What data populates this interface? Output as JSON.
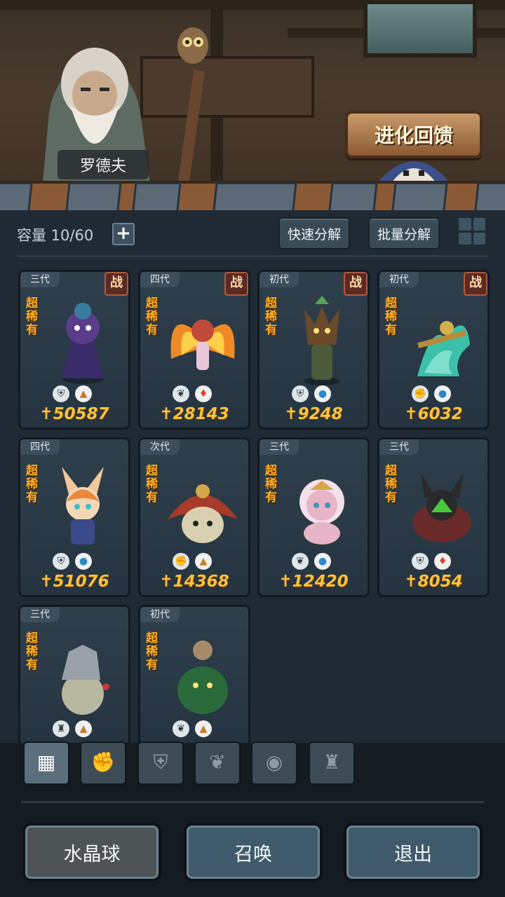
{
  "scene": {
    "npc_name": "罗德夫",
    "evolve_label": "进化回馈"
  },
  "toolbar": {
    "capacity_label": "容量 10/60",
    "add_label": "+",
    "quick_decompose": "快速分解",
    "batch_decompose": "批量分解"
  },
  "cards": [
    {
      "gen": "三代",
      "rarity": "超稀有",
      "battle": "战",
      "type_icon": "shield-icon",
      "element_icon": "earth-icon",
      "power": "50587"
    },
    {
      "gen": "四代",
      "rarity": "超稀有",
      "battle": "战",
      "type_icon": "leaf-icon",
      "element_icon": "fire-icon",
      "power": "28143"
    },
    {
      "gen": "初代",
      "rarity": "超稀有",
      "battle": "战",
      "type_icon": "shield-icon",
      "element_icon": "water-icon",
      "power": "9248"
    },
    {
      "gen": "初代",
      "rarity": "超稀有",
      "battle": "战",
      "type_icon": "fist-icon",
      "element_icon": "water-icon",
      "power": "6032"
    },
    {
      "gen": "四代",
      "rarity": "超稀有",
      "battle": "",
      "type_icon": "shield-icon",
      "element_icon": "water-icon",
      "power": "51076"
    },
    {
      "gen": "次代",
      "rarity": "超稀有",
      "battle": "",
      "type_icon": "fist-icon",
      "element_icon": "earth-icon",
      "power": "14368"
    },
    {
      "gen": "三代",
      "rarity": "超稀有",
      "battle": "",
      "type_icon": "leaf-icon",
      "element_icon": "water-icon",
      "power": "12420"
    },
    {
      "gen": "三代",
      "rarity": "超稀有",
      "battle": "",
      "type_icon": "shield-icon",
      "element_icon": "fire-icon",
      "power": "8054"
    },
    {
      "gen": "三代",
      "rarity": "超稀有",
      "battle": "",
      "type_icon": "tower-icon",
      "element_icon": "earth-icon",
      "power": ""
    },
    {
      "gen": "初代",
      "rarity": "超稀有",
      "battle": "",
      "type_icon": "leaf-icon",
      "element_icon": "earth-icon",
      "power": ""
    }
  ],
  "filter_tabs": [
    "all-icon",
    "fist-icon",
    "shield-icon",
    "leaf-icon",
    "alien-icon",
    "tower-icon"
  ],
  "footer": {
    "crystal_ball": "水晶球",
    "summon": "召唤",
    "exit": "退出"
  },
  "colors": {
    "rarity": "#ffb020",
    "power": "#ffc23c",
    "panel": "#1f2a34"
  }
}
